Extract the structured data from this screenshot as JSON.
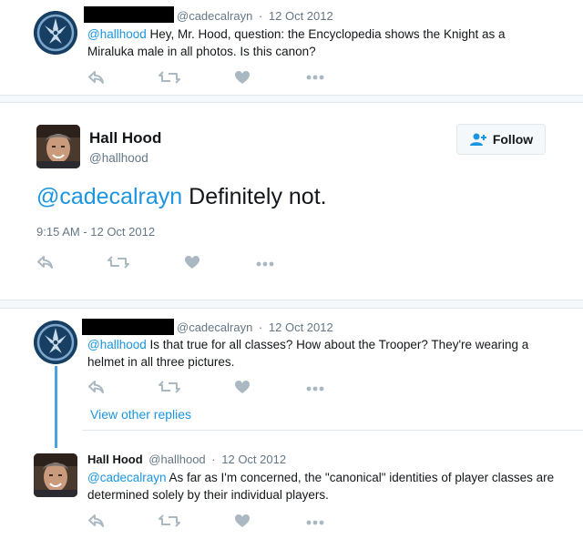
{
  "colors": {
    "accent": "#1b95e0",
    "muted": "#657786",
    "text": "#14171a",
    "border": "#e1e8ed",
    "thread_line": "#4aa2e0"
  },
  "tweet1": {
    "handle": "@cadecalrayn",
    "separator": "·",
    "date": "12 Oct 2012",
    "mention": "@hallhood",
    "text": " Hey, Mr. Hood, question: the Encyclopedia shows the Knight as a Miraluka male in all photos. Is this canon?"
  },
  "main": {
    "name": "Hall Hood",
    "handle": "@hallhood",
    "follow_label": "Follow",
    "mention": "@cadecalrayn",
    "text": " Definitely not.",
    "timestamp": "9:15 AM - 12 Oct 2012"
  },
  "tweet2": {
    "handle": "@cadecalrayn",
    "separator": "·",
    "date": "12 Oct 2012",
    "mention": "@hallhood",
    "text": " Is that true for all classes? How about the Trooper? They're wearing a helmet in all three pictures."
  },
  "view_other_replies": "View other replies",
  "tweet3": {
    "name": "Hall Hood",
    "handle": "@hallhood",
    "separator": "·",
    "date": "12 Oct 2012",
    "mention": "@cadecalrayn",
    "text": " As far as I'm concerned, the \"canonical\" identities of player classes are determined solely by their individual players."
  },
  "icons": {
    "reply": "reply-icon",
    "retweet": "retweet-icon",
    "like": "heart-icon",
    "more": "more-icon",
    "follow": "add-person-icon",
    "emblem": "republic-emblem-icon"
  }
}
